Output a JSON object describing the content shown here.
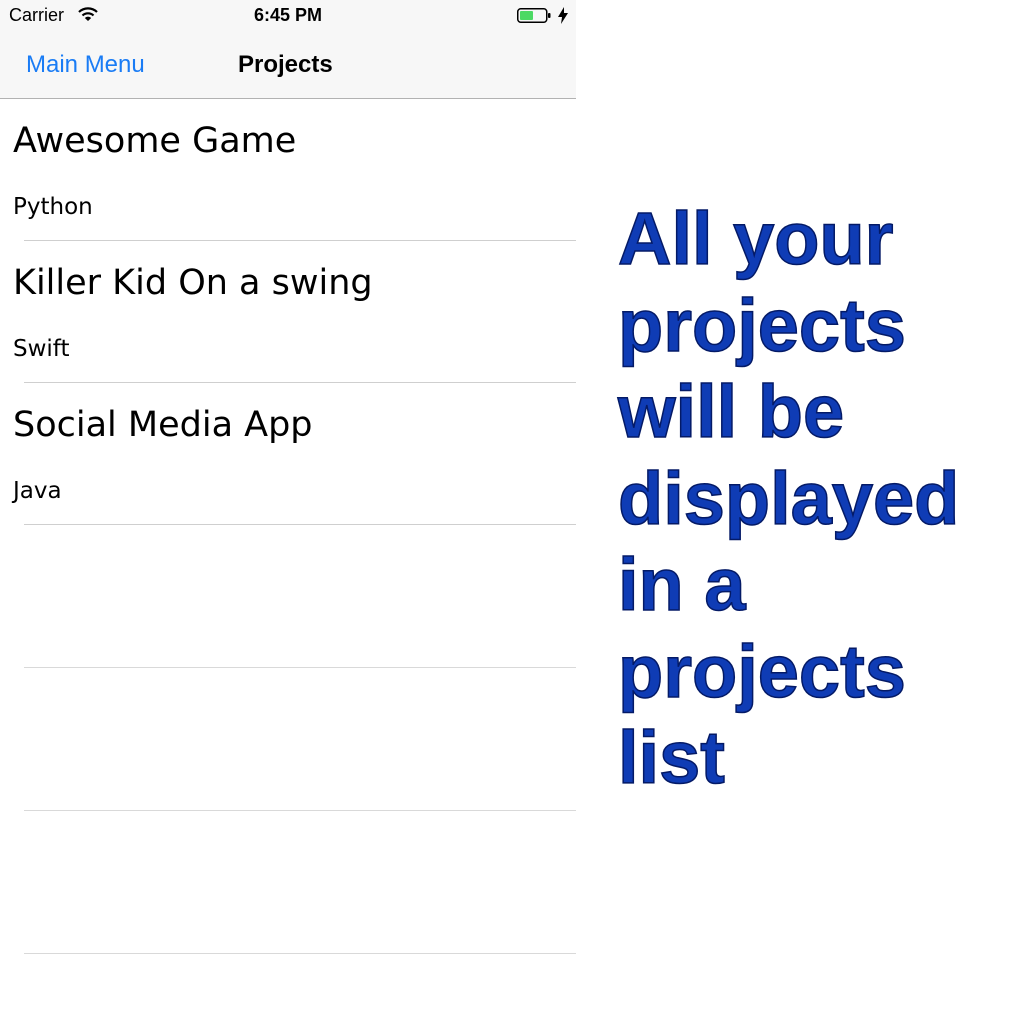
{
  "status_bar": {
    "carrier": "Carrier",
    "time": "6:45 PM",
    "wifi_icon": "wifi-icon",
    "battery_icon": "battery-icon",
    "charging_icon": "charging-bolt-icon",
    "battery_color": "#4cd964"
  },
  "nav": {
    "back_label": "Main Menu",
    "title": "Projects",
    "tint_color": "#1a7cf5"
  },
  "projects": [
    {
      "name": "Awesome Game",
      "language": "Python"
    },
    {
      "name": "Killer Kid On a swing",
      "language": "Swift"
    },
    {
      "name": "Social Media App",
      "language": "Java"
    }
  ],
  "caption": {
    "lines": [
      "All your",
      "projects",
      "will be",
      "displayed",
      "in a",
      "projects",
      "list"
    ],
    "color": "#0f3cb5"
  }
}
